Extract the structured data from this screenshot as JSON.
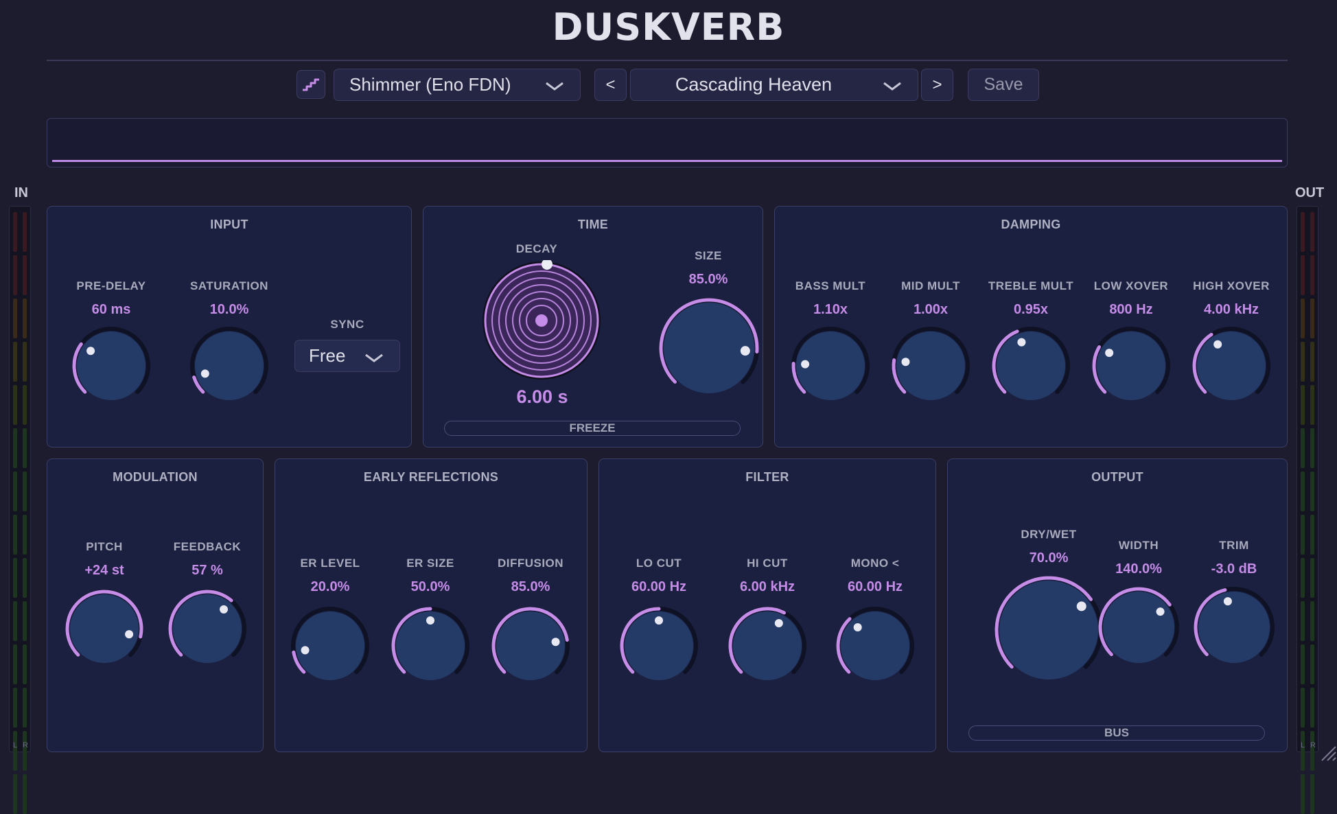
{
  "app": {
    "title": "DUSKVERB"
  },
  "header": {
    "algorithm": "Shimmer (Eno FDN)",
    "prev_label": "<",
    "preset": "Cascading Heaven",
    "next_label": ">",
    "save_label": "Save"
  },
  "meters": {
    "in_label": "IN",
    "out_label": "OUT",
    "left": "L",
    "right": "R"
  },
  "input": {
    "title": "INPUT",
    "predelay": {
      "label": "PRE-DELAY",
      "value": "60 ms",
      "level": 0.3
    },
    "saturation": {
      "label": "SATURATION",
      "value": "10.0%",
      "level": 0.1
    },
    "sync": {
      "label": "SYNC",
      "value": "Free"
    }
  },
  "time": {
    "title": "TIME",
    "decay": {
      "label": "DECAY",
      "value": "6.00 s"
    },
    "size": {
      "label": "SIZE",
      "value": "85.0%",
      "level": 0.85
    },
    "freeze_label": "FREEZE"
  },
  "damping": {
    "title": "DAMPING",
    "bass": {
      "label": "BASS MULT",
      "value": "1.10x",
      "level": 0.18
    },
    "mid": {
      "label": "MID MULT",
      "value": "1.00x",
      "level": 0.2
    },
    "treble": {
      "label": "TREBLE MULT",
      "value": "0.95x",
      "level": 0.42
    },
    "low_xover": {
      "label": "LOW XOVER",
      "value": "800 Hz",
      "level": 0.28
    },
    "high_xover": {
      "label": "HIGH XOVER",
      "value": "4.00 kHz",
      "level": 0.38
    }
  },
  "modulation": {
    "title": "MODULATION",
    "pitch": {
      "label": "PITCH",
      "value": "+24 st",
      "level": 0.88
    },
    "feedback": {
      "label": "FEEDBACK",
      "value": "57 %",
      "level": 0.65
    }
  },
  "early": {
    "title": "EARLY REFLECTIONS",
    "er_level": {
      "label": "ER LEVEL",
      "value": "20.0%",
      "level": 0.13
    },
    "er_size": {
      "label": "ER SIZE",
      "value": "50.0%",
      "level": 0.5
    },
    "diffusion": {
      "label": "DIFFUSION",
      "value": "85.0%",
      "level": 0.8
    }
  },
  "filter": {
    "title": "FILTER",
    "lo_cut": {
      "label": "LO CUT",
      "value": "60.00 Hz",
      "level": 0.5
    },
    "hi_cut": {
      "label": "HI CUT",
      "value": "6.00 kHz",
      "level": 0.6
    },
    "mono": {
      "label": "MONO <",
      "value": "60.00 Hz",
      "level": 0.34
    }
  },
  "output": {
    "title": "OUTPUT",
    "drywet": {
      "label": "DRY/WET",
      "value": "70.0%",
      "level": 0.7
    },
    "width": {
      "label": "WIDTH",
      "value": "140.0%",
      "level": 0.7
    },
    "trim": {
      "label": "TRIM",
      "value": "-3.0 dB",
      "level": 0.45
    },
    "bus_label": "BUS"
  },
  "colors": {
    "accent": "#c58ce8",
    "knob_fill": "#243b68",
    "panel": "#1b2040",
    "background": "#1c1c2e"
  }
}
